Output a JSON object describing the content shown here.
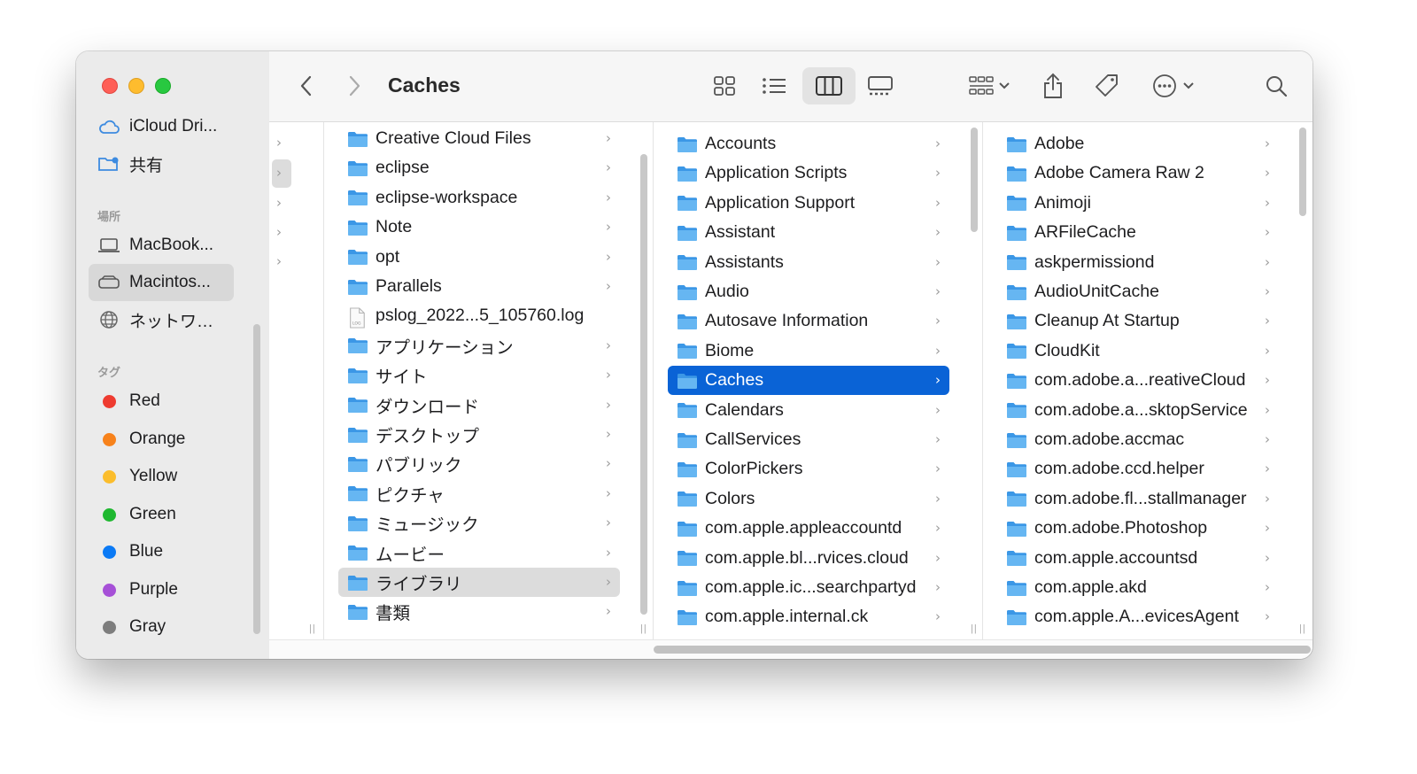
{
  "window": {
    "title": "Caches"
  },
  "colors": {
    "accent": "#0a63d6",
    "folder": "#4aa8ee",
    "sidebar_bg": "#ebebeb"
  },
  "sidebar": {
    "top_items": [
      {
        "label": "iCloud Dri...",
        "icon": "cloud-icon"
      },
      {
        "label": "共有",
        "icon": "shared-folder-icon"
      }
    ],
    "locations_header": "場所",
    "locations": [
      {
        "label": "MacBook...",
        "icon": "laptop-icon"
      },
      {
        "label": "Macintos...",
        "icon": "hard-drive-icon",
        "selected": true
      },
      {
        "label": "ネットワ…",
        "icon": "globe-icon"
      }
    ],
    "tags_header": "タグ",
    "tags": [
      {
        "label": "Red",
        "color": "#ee3b30"
      },
      {
        "label": "Orange",
        "color": "#f7821b"
      },
      {
        "label": "Yellow",
        "color": "#fbbd2c"
      },
      {
        "label": "Green",
        "color": "#1fb830"
      },
      {
        "label": "Blue",
        "color": "#0b7af5"
      },
      {
        "label": "Purple",
        "color": "#a650d7"
      },
      {
        "label": "Gray",
        "color": "#7d7d7d"
      }
    ]
  },
  "toolbar": {
    "back_icon": "chevron-left-icon",
    "forward_icon": "chevron-right-icon",
    "view_icons": [
      "icon-view-icon",
      "list-view-icon",
      "column-view-icon",
      "gallery-view-icon"
    ],
    "active_view": "column-view-icon",
    "group_icon": "group-icon",
    "share_icon": "share-icon",
    "tag_icon": "tag-icon",
    "action_icon": "more-icon",
    "search_icon": "search-icon"
  },
  "column2": [
    {
      "name": "Creative Cloud Files",
      "kind": "folder",
      "arrow": true
    },
    {
      "name": "eclipse",
      "kind": "folder",
      "arrow": true
    },
    {
      "name": "eclipse-workspace",
      "kind": "folder",
      "arrow": true
    },
    {
      "name": "Note",
      "kind": "folder",
      "arrow": true
    },
    {
      "name": "opt",
      "kind": "folder",
      "arrow": true
    },
    {
      "name": "Parallels",
      "kind": "folder",
      "arrow": true
    },
    {
      "name": "pslog_2022...5_105760.log",
      "kind": "log",
      "arrow": false
    },
    {
      "name": "アプリケーション",
      "kind": "folder",
      "arrow": true
    },
    {
      "name": "サイト",
      "kind": "folder",
      "arrow": true
    },
    {
      "name": "ダウンロード",
      "kind": "folder",
      "arrow": true
    },
    {
      "name": "デスクトップ",
      "kind": "folder",
      "arrow": true
    },
    {
      "name": "パブリック",
      "kind": "folder",
      "arrow": true
    },
    {
      "name": "ピクチャ",
      "kind": "folder",
      "arrow": true
    },
    {
      "name": "ミュージック",
      "kind": "folder",
      "arrow": true
    },
    {
      "name": "ムービー",
      "kind": "folder",
      "arrow": true
    },
    {
      "name": "ライブラリ",
      "kind": "folder",
      "arrow": true,
      "highlighted": true
    },
    {
      "name": "書類",
      "kind": "folder",
      "arrow": true
    }
  ],
  "column3": [
    {
      "name": "Accounts"
    },
    {
      "name": "Application Scripts"
    },
    {
      "name": "Application Support"
    },
    {
      "name": "Assistant"
    },
    {
      "name": "Assistants"
    },
    {
      "name": "Audio"
    },
    {
      "name": "Autosave Information"
    },
    {
      "name": "Biome"
    },
    {
      "name": "Caches",
      "selected": true
    },
    {
      "name": "Calendars"
    },
    {
      "name": "CallServices"
    },
    {
      "name": "ColorPickers"
    },
    {
      "name": "Colors"
    },
    {
      "name": "com.apple.appleaccountd"
    },
    {
      "name": "com.apple.bl...rvices.cloud"
    },
    {
      "name": "com.apple.ic...searchpartyd"
    },
    {
      "name": "com.apple.internal.ck"
    }
  ],
  "column4": [
    {
      "name": "Adobe"
    },
    {
      "name": "Adobe Camera Raw 2"
    },
    {
      "name": "Animoji"
    },
    {
      "name": "ARFileCache"
    },
    {
      "name": "askpermissiond"
    },
    {
      "name": "AudioUnitCache"
    },
    {
      "name": "Cleanup At Startup"
    },
    {
      "name": "CloudKit"
    },
    {
      "name": "com.adobe.a...reativeCloud"
    },
    {
      "name": "com.adobe.a...sktopService"
    },
    {
      "name": "com.adobe.accmac"
    },
    {
      "name": "com.adobe.ccd.helper"
    },
    {
      "name": "com.adobe.fl...stallmanager"
    },
    {
      "name": "com.adobe.Photoshop"
    },
    {
      "name": "com.apple.accountsd"
    },
    {
      "name": "com.apple.akd"
    },
    {
      "name": "com.apple.A...evicesAgent"
    }
  ]
}
